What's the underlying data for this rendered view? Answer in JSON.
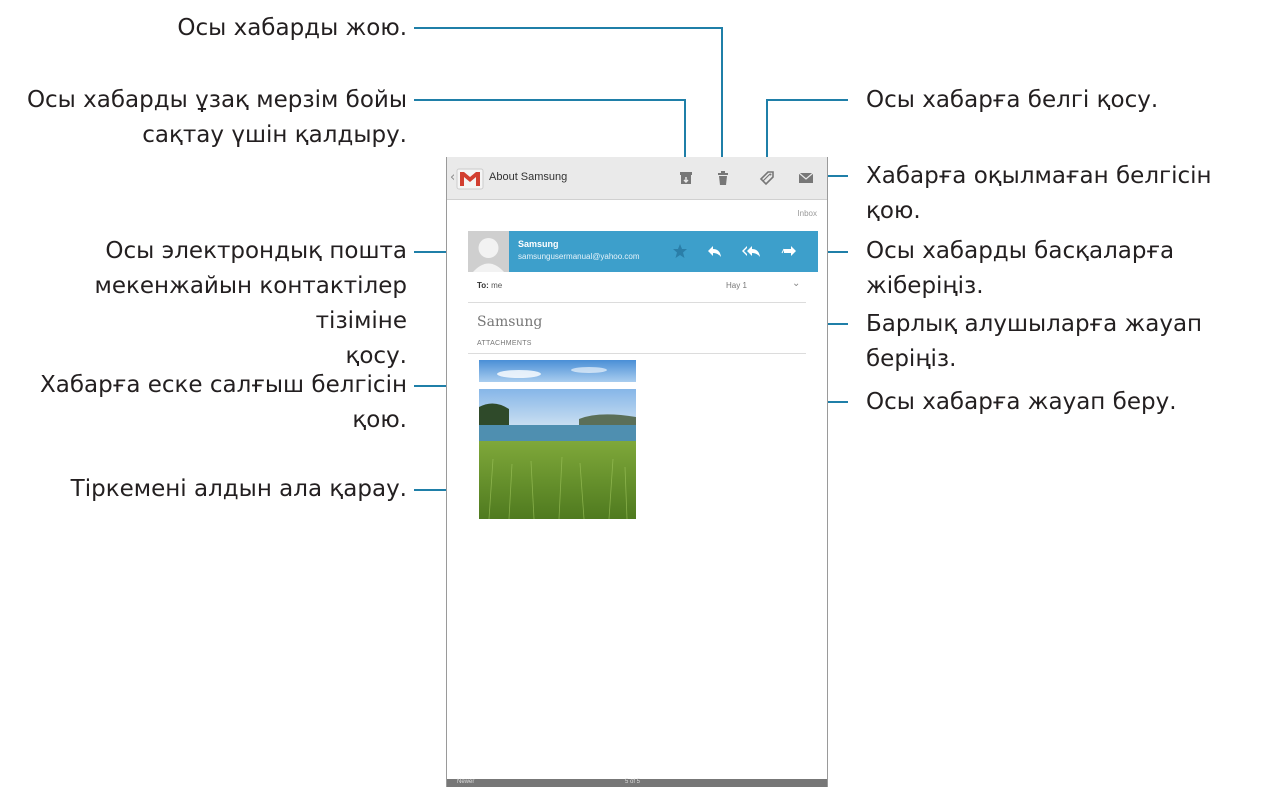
{
  "callouts": {
    "delete": "Осы хабарды жою.",
    "archive_line1": "Осы хабарды ұзақ мерзім бойы",
    "archive_line2": "сақтау үшін қалдыру.",
    "add_contact_line1": "Осы электрондық пошта",
    "add_contact_line2": "мекенжайын контактілер тізіміне",
    "add_contact_line3": "қосу.",
    "reminder_line1": "Хабарға еске салғыш белгісін",
    "reminder_line2": "қою.",
    "preview": "Тіркемені алдын ала қарау.",
    "label": "Осы хабарға белгі қосу.",
    "unread": "Хабарға оқылмаған белгісін қою.",
    "forward_line1": "Осы хабарды басқаларға",
    "forward_line2": "жіберіңіз.",
    "reply_all_line1": "Барлық алушыларға жауап",
    "reply_all_line2": "беріңіз.",
    "reply": "Осы хабарға жауап беру."
  },
  "screen": {
    "action_bar": {
      "title": "About Samsung",
      "icons": [
        "archive-icon",
        "delete-icon",
        "label-icon",
        "mark-unread-icon"
      ]
    },
    "folder": "Inbox",
    "sender": {
      "name": "Samsung",
      "email": "samsungusermanual@yahoo.com",
      "icons": [
        "star-icon",
        "reply-icon",
        "reply-all-icon",
        "forward-icon"
      ]
    },
    "to_prefix": "To:",
    "to_value": "me",
    "date": "Hay 1",
    "subject": "Samsung",
    "attachments_label": "ATTACHMENTS",
    "bottom": {
      "newer": "Newer",
      "position": "5 of 5"
    }
  },
  "colors": {
    "accent": "#3d9fcb",
    "leader_line": "#1f7fa8",
    "action_bar": "#eaeaea"
  }
}
